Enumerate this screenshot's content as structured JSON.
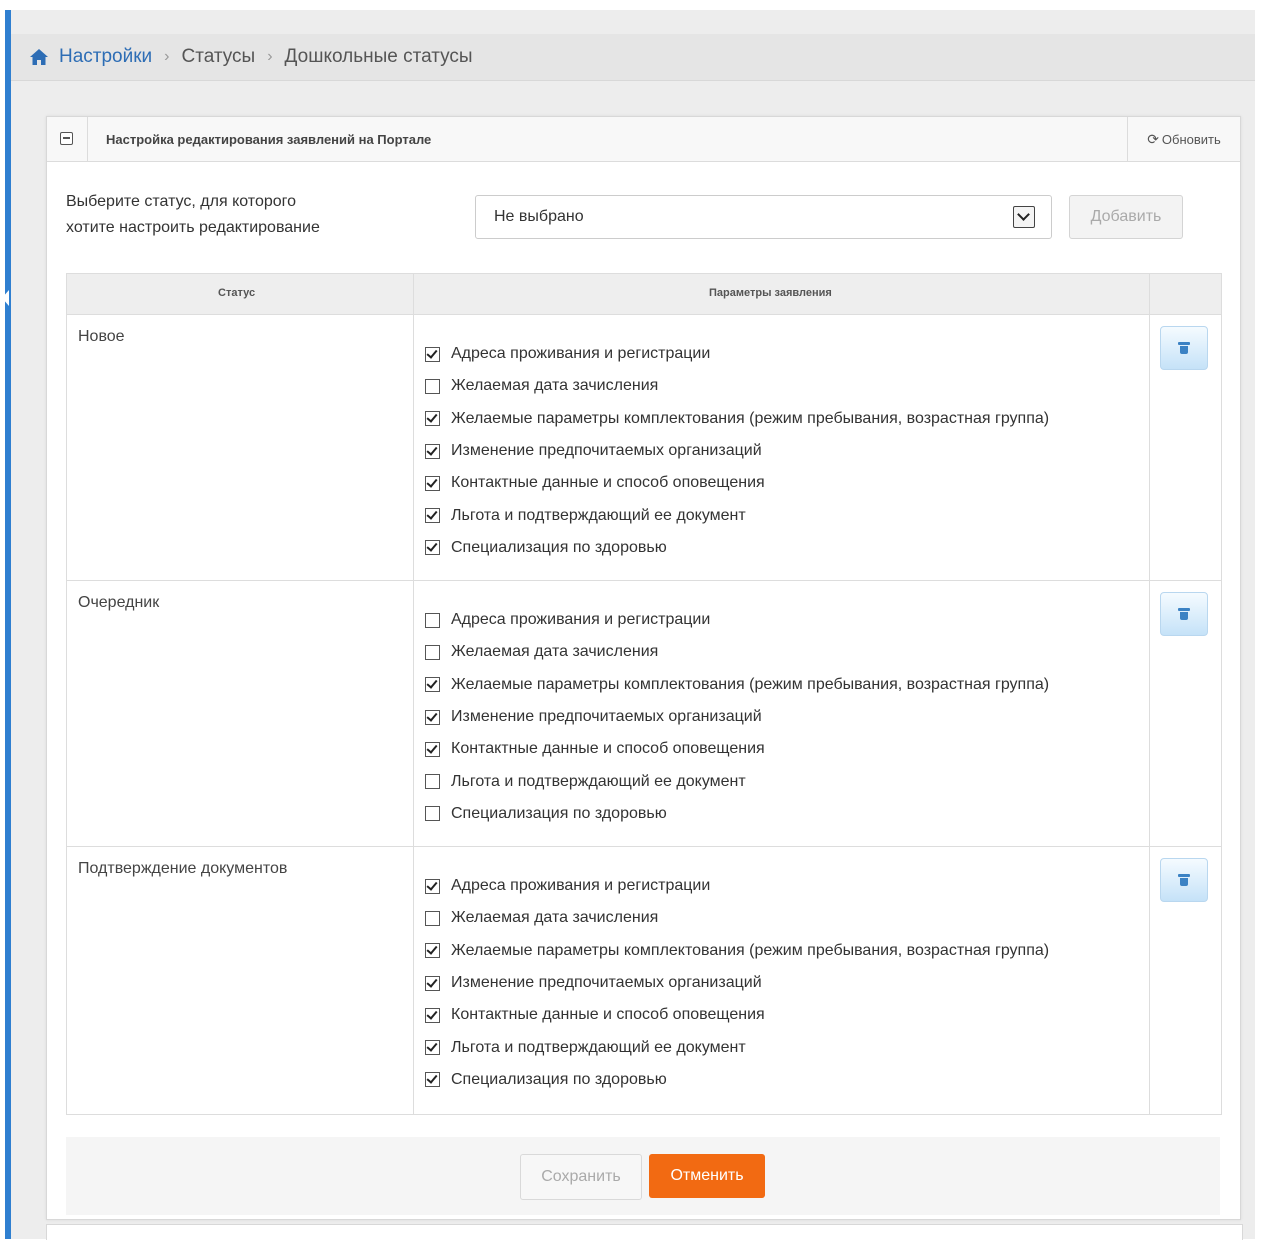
{
  "breadcrumb": {
    "home": "Настройки",
    "level2": "Статусы",
    "level3": "Дошкольные статусы"
  },
  "panel": {
    "title": "Настройка редактирования заявлений на Портале",
    "refresh_label": "Обновить"
  },
  "selector": {
    "label_line1": "Выберите статус, для которого",
    "label_line2": "хотите настроить редактирование",
    "value": "Не выбрано",
    "add_label": "Добавить"
  },
  "table": {
    "headers": {
      "status": "Статус",
      "params": "Параметры заявления"
    },
    "rows": [
      {
        "status": "Новое",
        "params": [
          {
            "label": "Адреса проживания и регистрации",
            "checked": true
          },
          {
            "label": "Желаемая дата зачисления",
            "checked": false
          },
          {
            "label": "Желаемые параметры комплектования (режим пребывания, возрастная группа)",
            "checked": true
          },
          {
            "label": "Изменение предпочитаемых организаций",
            "checked": true
          },
          {
            "label": "Контактные данные и способ оповещения",
            "checked": true
          },
          {
            "label": "Льгота и подтверждающий ее документ",
            "checked": true
          },
          {
            "label": "Специализация по здоровью",
            "checked": true
          }
        ]
      },
      {
        "status": "Очередник",
        "params": [
          {
            "label": "Адреса проживания и регистрации",
            "checked": false
          },
          {
            "label": "Желаемая дата зачисления",
            "checked": false
          },
          {
            "label": "Желаемые параметры комплектования (режим пребывания, возрастная группа)",
            "checked": true
          },
          {
            "label": "Изменение предпочитаемых организаций",
            "checked": true
          },
          {
            "label": "Контактные данные и способ оповещения",
            "checked": true
          },
          {
            "label": "Льгота и подтверждающий ее документ",
            "checked": false
          },
          {
            "label": "Специализация по здоровью",
            "checked": false
          }
        ]
      },
      {
        "status": "Подтверждение документов",
        "params": [
          {
            "label": "Адреса проживания и регистрации",
            "checked": true
          },
          {
            "label": "Желаемая дата зачисления",
            "checked": false
          },
          {
            "label": "Желаемые параметры комплектования (режим пребывания, возрастная группа)",
            "checked": true
          },
          {
            "label": "Изменение предпочитаемых организаций",
            "checked": true
          },
          {
            "label": "Контактные данные и способ оповещения",
            "checked": true
          },
          {
            "label": "Льгота и подтверждающий ее документ",
            "checked": true
          },
          {
            "label": "Специализация по здоровью",
            "checked": true
          }
        ]
      }
    ]
  },
  "footer": {
    "save_label": "Сохранить",
    "cancel_label": "Отменить"
  },
  "colors": {
    "accent": "#2d6db5",
    "cancel": "#f26a12",
    "sidebar": "#2f7fd0"
  },
  "icons": {
    "home": "home-icon",
    "refresh": "refresh-icon",
    "delete": "trash-icon",
    "collapse": "collapse-icon"
  }
}
